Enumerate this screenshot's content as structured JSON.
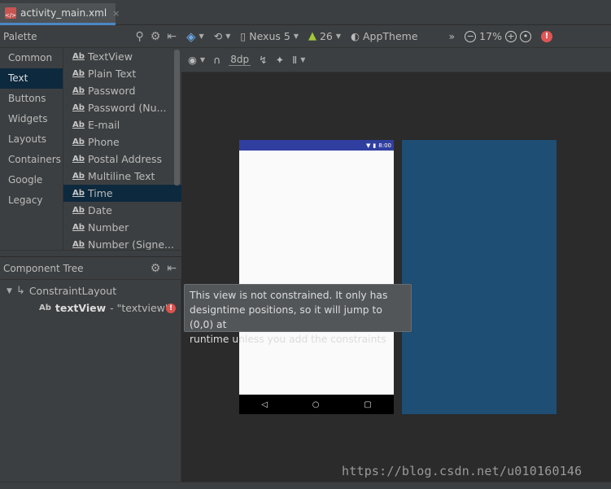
{
  "tab": {
    "file": "activity_main.xml",
    "close": "×"
  },
  "palette": {
    "title": "Palette",
    "categories": [
      "Common",
      "Text",
      "Buttons",
      "Widgets",
      "Layouts",
      "Containers",
      "Google",
      "Legacy"
    ],
    "selected_category": "Text",
    "items": [
      {
        "icon": "Ab",
        "label": "TextView"
      },
      {
        "icon": "Ab",
        "label": "Plain Text"
      },
      {
        "icon": "Ab",
        "label": "Password"
      },
      {
        "icon": "Ab",
        "label": "Password (Nu..."
      },
      {
        "icon": "Ab",
        "label": "E-mail"
      },
      {
        "icon": "Ab",
        "label": "Phone"
      },
      {
        "icon": "Ab",
        "label": "Postal Address"
      },
      {
        "icon": "Ab",
        "label": "Multiline Text"
      },
      {
        "icon": "Ab",
        "label": "Time"
      },
      {
        "icon": "Ab",
        "label": "Date"
      },
      {
        "icon": "Ab",
        "label": "Number"
      },
      {
        "icon": "Ab",
        "label": "Number (Signe..."
      }
    ],
    "selected_item": "Time"
  },
  "component_tree": {
    "title": "Component Tree",
    "root": "ConstraintLayout",
    "child_icon": "Ab",
    "child_name": "textView",
    "child_id": "- \"textview\""
  },
  "toolbar": {
    "device": "Nexus 5",
    "api": "26",
    "theme": "AppTheme",
    "zoom": "17%",
    "margin": "8dp",
    "overflow": "»"
  },
  "phone": {
    "time": "8:00"
  },
  "tooltip": {
    "line1": "This view is not constrained. It only has",
    "line2": "designtime positions, so it will jump to (0,0) at",
    "line3": "runtime unless you add the constraints"
  },
  "watermark": "https://blog.csdn.net/u010160146",
  "colors": {
    "accent_tab": "#4a88c7",
    "selection": "#0d293e",
    "status_bar": "#303f9f",
    "blueprint": "#1f4e74",
    "error": "#d9534f"
  }
}
